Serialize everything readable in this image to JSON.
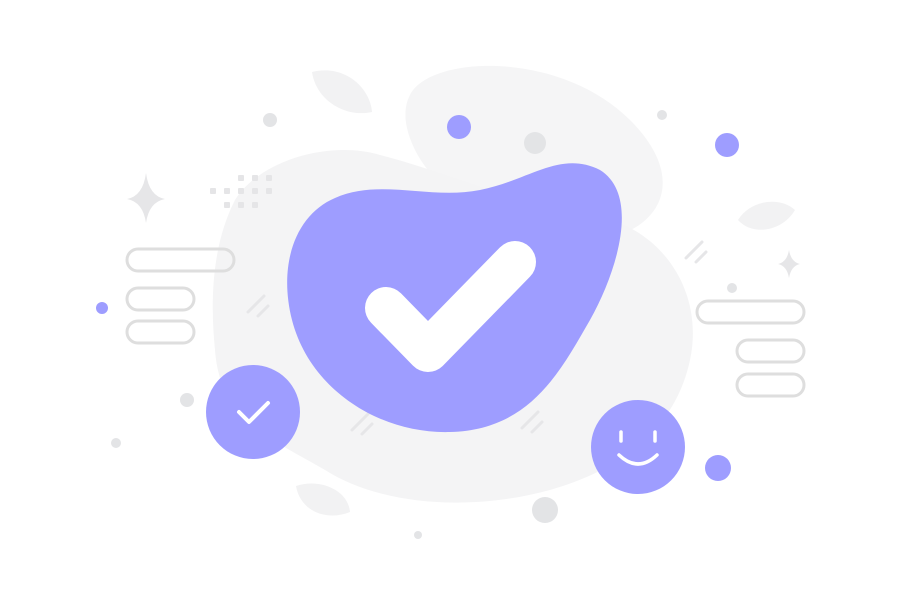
{
  "illustration": {
    "subject": "success",
    "icons": {
      "main": "check-icon",
      "badge": "check-icon",
      "face": "smile-icon",
      "sparkle": "sparkle-icon",
      "leaf": "leaf-icon"
    },
    "colors": {
      "accent": "#9e9dff",
      "background_blob": "#f4f4f5",
      "dot_grey": "#e3e4e6",
      "outline_grey": "#dcdcdc",
      "white": "#ffffff"
    }
  }
}
